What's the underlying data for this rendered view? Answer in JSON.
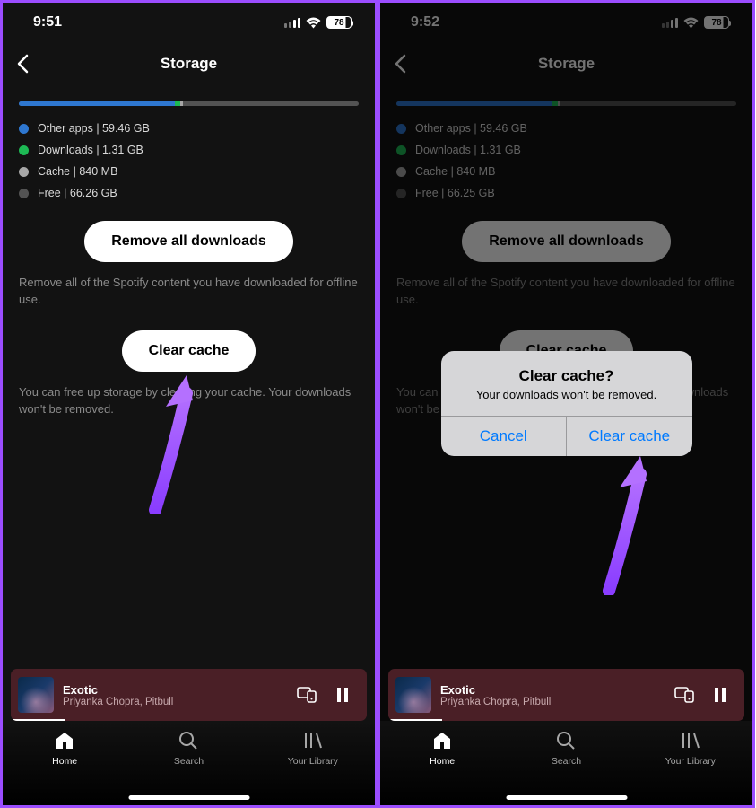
{
  "left": {
    "status": {
      "time": "9:51",
      "battery": "78"
    },
    "header": {
      "title": "Storage"
    },
    "legend": {
      "other": "Other apps | 59.46 GB",
      "downloads": "Downloads | 1.31 GB",
      "cache": "Cache | 840 MB",
      "free": "Free | 66.26 GB"
    },
    "buttons": {
      "remove_downloads": "Remove all downloads",
      "clear_cache": "Clear cache"
    },
    "help": {
      "remove": "Remove all of the Spotify content you have downloaded for offline use.",
      "cache": "You can free up storage by clearing your cache. Your downloads won't be removed."
    },
    "now_playing": {
      "title": "Exotic",
      "artist": "Priyanka Chopra, Pitbull"
    },
    "nav": {
      "home": "Home",
      "search": "Search",
      "library": "Your Library"
    }
  },
  "right": {
    "status": {
      "time": "9:52",
      "battery": "78"
    },
    "header": {
      "title": "Storage"
    },
    "legend": {
      "other": "Other apps | 59.46 GB",
      "downloads": "Downloads | 1.31 GB",
      "cache": "Cache | 840 MB",
      "free": "Free | 66.25 GB"
    },
    "buttons": {
      "remove_downloads": "Remove all downloads",
      "clear_cache": "Clear cache"
    },
    "help": {
      "remove": "Remove all of the Spotify content you have downloaded for offline use.",
      "cache": "You can free up storage by clearing your cache. Your downloads won't be removed."
    },
    "now_playing": {
      "title": "Exotic",
      "artist": "Priyanka Chopra, Pitbull"
    },
    "nav": {
      "home": "Home",
      "search": "Search",
      "library": "Your Library"
    },
    "dialog": {
      "title": "Clear cache?",
      "message": "Your downloads won't be removed.",
      "cancel": "Cancel",
      "confirm": "Clear cache"
    }
  }
}
